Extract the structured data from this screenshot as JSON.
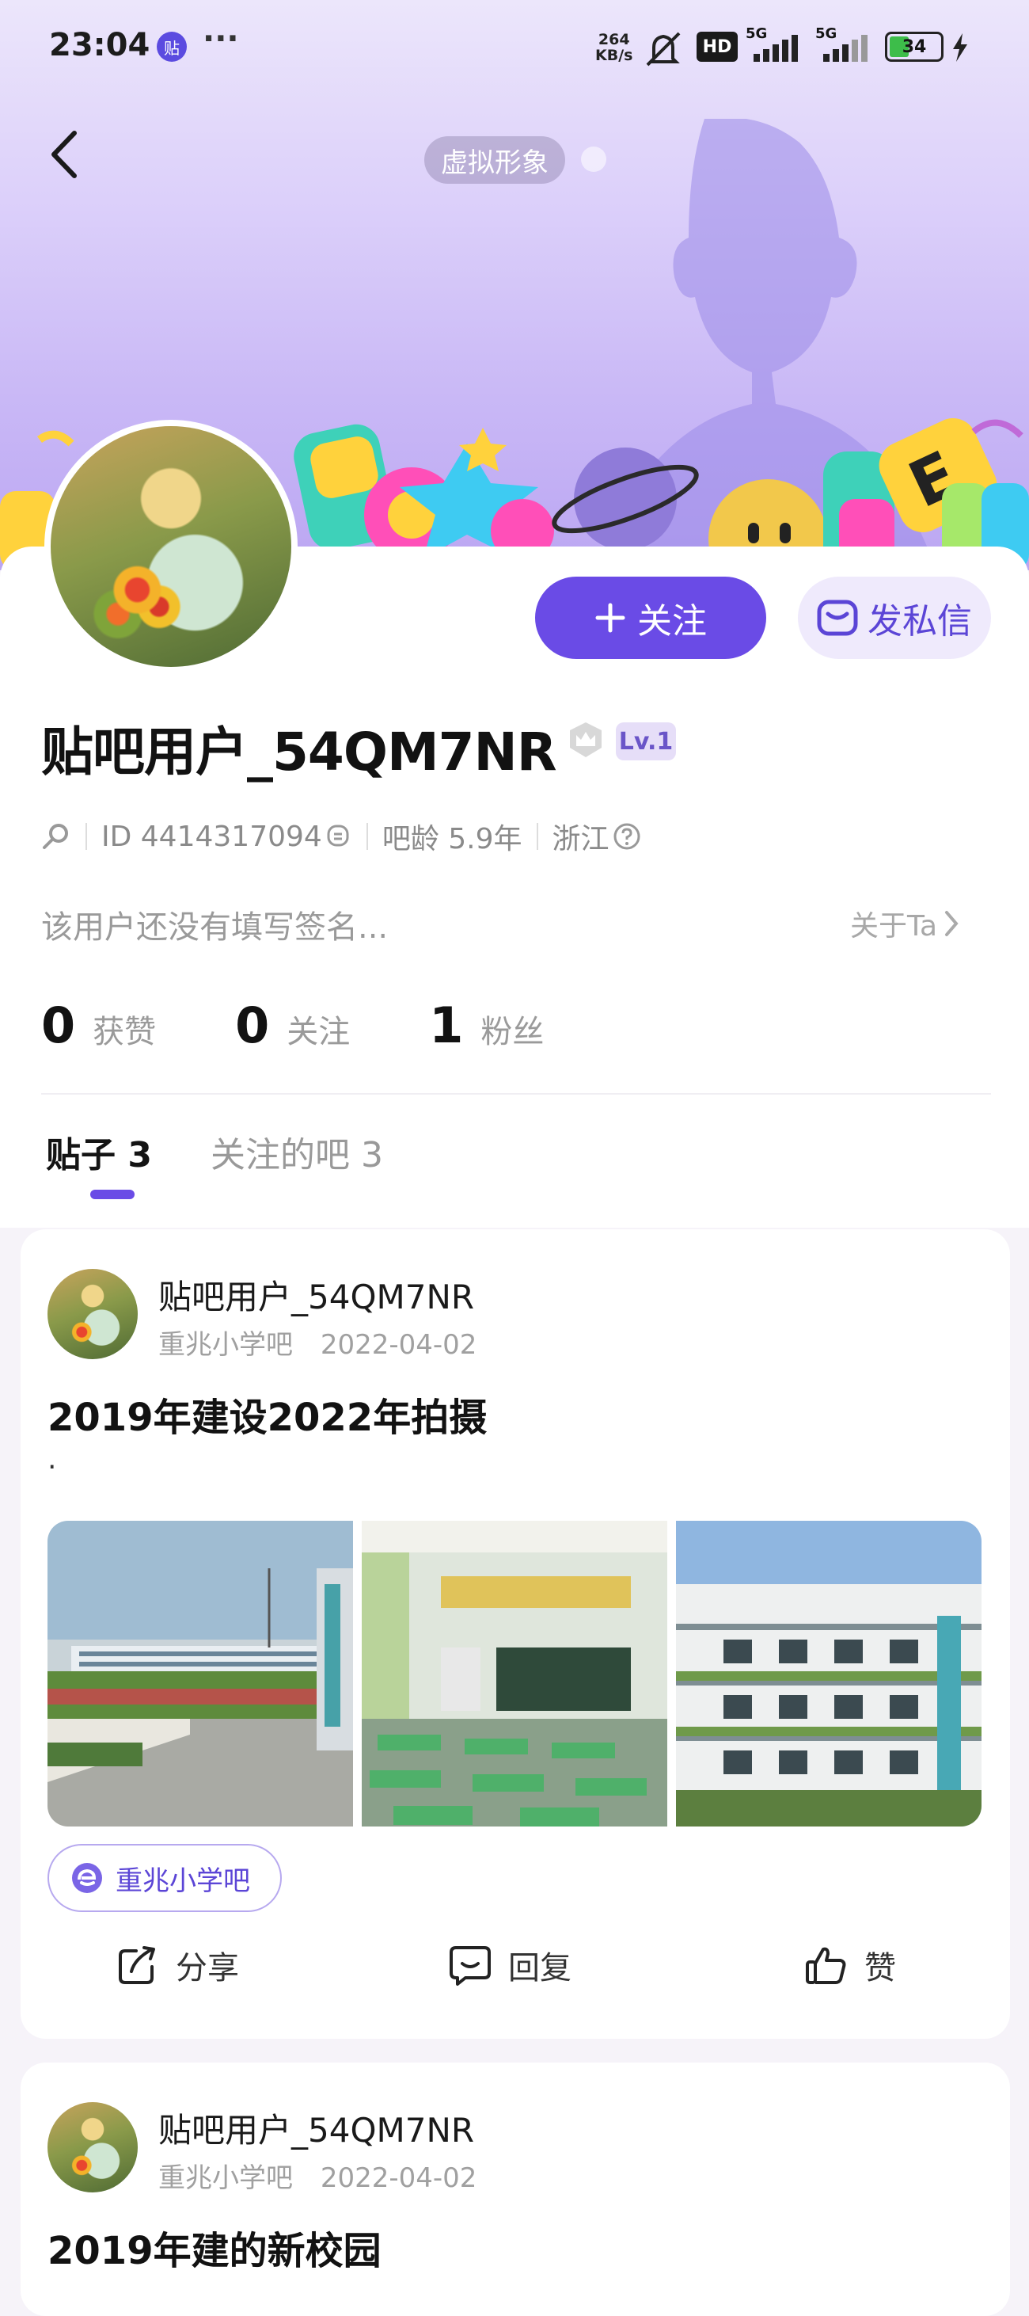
{
  "status_bar": {
    "time": "23:04",
    "app_badge": "贴",
    "more": "···",
    "net_speed_value": "264",
    "net_speed_unit": "KB/s",
    "network_1": "5G",
    "network_2": "5G",
    "hd_badge": "HD",
    "battery": "34"
  },
  "header": {
    "virtual_image_label": "虚拟形象"
  },
  "profile": {
    "follow_button": "关注",
    "message_button": "发私信",
    "username": "贴吧用户_54QM7NR",
    "level": "Lv.1",
    "user_id": "ID 4414317094",
    "bar_age": "吧龄 5.9年",
    "location": "浙江",
    "signature": "该用户还没有填写签名...",
    "about_link": "关于Ta",
    "stats": [
      {
        "value": "0",
        "label": "获赞"
      },
      {
        "value": "0",
        "label": "关注"
      },
      {
        "value": "1",
        "label": "粉丝"
      }
    ]
  },
  "tabs": {
    "posts": "贴子 3",
    "followed_bars": "关注的吧 3"
  },
  "posts": [
    {
      "author": "贴吧用户_54QM7NR",
      "forum": "重兆小学吧",
      "date": "2022-04-02",
      "title": "2019年建设2022年拍摄",
      "body": ".",
      "forum_tag": "重兆小学吧",
      "actions": {
        "share": "分享",
        "reply": "回复",
        "like": "赞"
      }
    },
    {
      "author": "贴吧用户_54QM7NR",
      "forum": "重兆小学吧",
      "date": "2022-04-02",
      "title": "2019年建的新校园"
    }
  ],
  "colors": {
    "accent": "#6a4be6",
    "banner_top": "#ece6fb",
    "banner_bottom": "#bba6f2"
  }
}
